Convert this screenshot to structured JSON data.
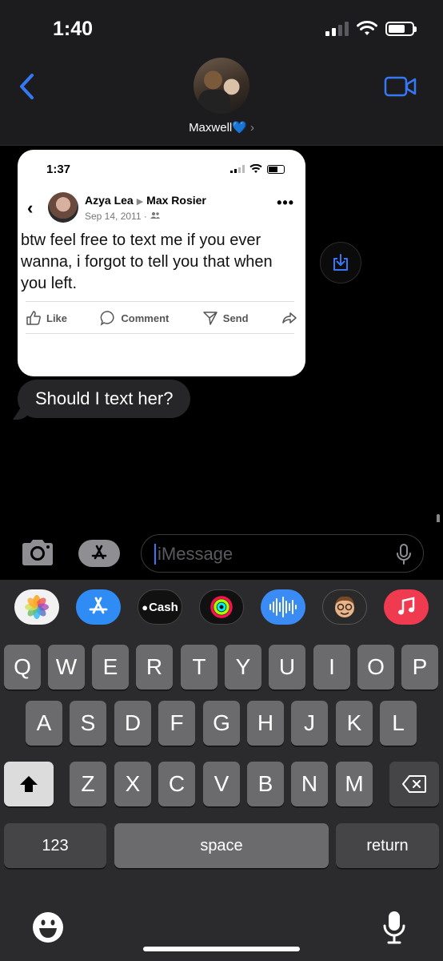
{
  "status_bar": {
    "time": "1:40"
  },
  "header": {
    "contact_name": "Maxwell",
    "heart": "💙",
    "chevron": "›"
  },
  "shared_screenshot": {
    "time": "1:37",
    "author": "Azya Lea",
    "recipient": "Max Rosier",
    "date": "Sep 14, 2011 ·",
    "more": "•••",
    "text": "btw feel free to text me if you ever wanna, i forgot to tell you that when you left.",
    "actions": {
      "like": "Like",
      "comment": "Comment",
      "send": "Send"
    }
  },
  "messages": [
    {
      "text": "Should I text her?"
    }
  ],
  "input": {
    "placeholder": "iMessage"
  },
  "app_drawer": {
    "cash_label": "Cash"
  },
  "keyboard": {
    "row1": [
      "Q",
      "W",
      "E",
      "R",
      "T",
      "Y",
      "U",
      "I",
      "O",
      "P"
    ],
    "row2": [
      "A",
      "S",
      "D",
      "F",
      "G",
      "H",
      "J",
      "K",
      "L"
    ],
    "row3": [
      "Z",
      "X",
      "C",
      "V",
      "B",
      "N",
      "M"
    ],
    "numbers_label": "123",
    "space_label": "space",
    "return_label": "return"
  },
  "colors": {
    "accent": "#3478f6",
    "bubble": "#262628",
    "keyboard_bg": "#2b2b2d",
    "key": "#6b6b6e"
  },
  "icons": [
    "back-chevron-icon",
    "video-camera-icon",
    "download-icon",
    "camera-icon",
    "app-store-icon",
    "mic-icon",
    "shift-icon",
    "delete-icon",
    "emoji-icon",
    "dictation-icon"
  ]
}
